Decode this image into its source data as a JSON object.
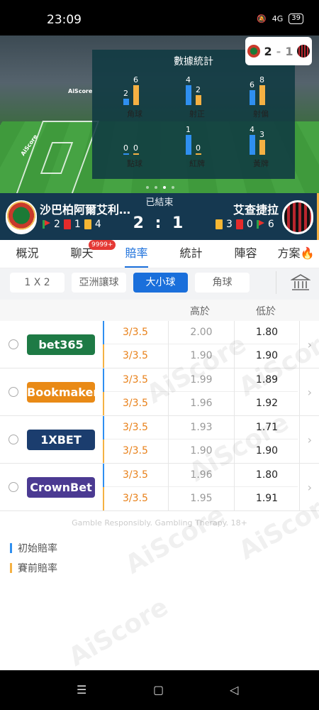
{
  "status_bar": {
    "time": "23:09",
    "battery": "39",
    "network": "4G"
  },
  "stats_panel": {
    "title": "數據統計",
    "items": [
      {
        "label": "角球",
        "home": "2",
        "away": "6",
        "home_frac": 0.33,
        "away_frac": 1.0
      },
      {
        "label": "射正",
        "home": "4",
        "away": "2",
        "home_frac": 1.0,
        "away_frac": 0.5
      },
      {
        "label": "射偏",
        "home": "6",
        "away": "8",
        "home_frac": 0.75,
        "away_frac": 1.0
      },
      {
        "label": "點球",
        "home": "0",
        "away": "0",
        "home_frac": 0.05,
        "away_frac": 0.05
      },
      {
        "label": "紅牌",
        "home": "1",
        "away": "0",
        "home_frac": 1.0,
        "away_frac": 0.05
      },
      {
        "label": "黃牌",
        "home": "4",
        "away": "3",
        "home_frac": 1.0,
        "away_frac": 0.75
      }
    ]
  },
  "score_badge": {
    "home": "2",
    "sep": "-",
    "away": "1"
  },
  "match": {
    "status": "已結束",
    "home_team": "沙巴柏阿爾艾利…",
    "away_team": "艾查捷拉",
    "score": "2 : 1",
    "home_corners": "2",
    "home_red": "1",
    "home_yellow": "4",
    "away_yellow": "3",
    "away_red": "0",
    "away_corners": "6"
  },
  "tabs": [
    {
      "label": "概況"
    },
    {
      "label": "聊天",
      "badge": "9999+"
    },
    {
      "label": "賠率"
    },
    {
      "label": "統計"
    },
    {
      "label": "陣容"
    },
    {
      "label": "方案"
    }
  ],
  "subtabs": [
    "1 X 2",
    "亞洲讓球",
    "大小球",
    "角球"
  ],
  "table": {
    "col_over": "高於",
    "col_under": "低於",
    "bookmakers": [
      {
        "name": "bet365",
        "color": "#1e7a45",
        "initial": {
          "line": "3/3.5",
          "over": "2.00",
          "under": "1.80"
        },
        "pre": {
          "line": "3/3.5",
          "over": "1.90",
          "under": "1.90"
        }
      },
      {
        "name": "Bookmaker",
        "color": "#e98a16",
        "initial": {
          "line": "3/3.5",
          "over": "1.99",
          "under": "1.89"
        },
        "pre": {
          "line": "3/3.5",
          "over": "1.96",
          "under": "1.92"
        }
      },
      {
        "name": "1XBET",
        "color": "#1b3d6e",
        "initial": {
          "line": "3/3.5",
          "over": "1.93",
          "under": "1.71"
        },
        "pre": {
          "line": "3/3.5",
          "over": "1.90",
          "under": "1.90"
        }
      },
      {
        "name": "CrownBet",
        "color": "#4b3a92",
        "initial": {
          "line": "3/3.5",
          "over": "1.96",
          "under": "1.80"
        },
        "pre": {
          "line": "3/3.5",
          "over": "1.95",
          "under": "1.91"
        }
      }
    ]
  },
  "gamble_text": "Gamble Responsibly. Gambling Therapy. 18+",
  "legend": {
    "initial": "初始賠率",
    "pre": "賽前賠率"
  },
  "watermark": "AiScore",
  "colors": {
    "accent": "#1a6fdb",
    "initial_mark": "#2f8ff0",
    "pre_mark": "#f5b143",
    "line_text": "#e8811a"
  }
}
